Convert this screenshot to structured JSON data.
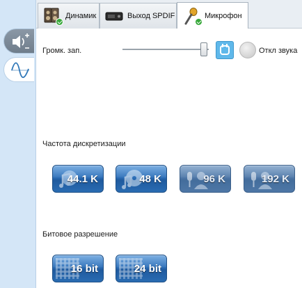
{
  "tabs": [
    {
      "label": "Динамик",
      "icon": "speaker-icon",
      "active": false
    },
    {
      "label": "Выход SPDIF",
      "icon": "spdif-icon",
      "active": false
    },
    {
      "label": "Микрофон",
      "icon": "microphone-icon",
      "active": true
    }
  ],
  "side": {
    "speaker_icon": "speaker-plus-minus-icon",
    "wave_icon": "waveform-icon"
  },
  "volume": {
    "label": "Громк. зап.",
    "level_percent": 100,
    "mute_label": "Откл звука"
  },
  "sample_rate": {
    "label": "Частота дискретизации",
    "options": [
      {
        "label": "44.1 K",
        "selected": true
      },
      {
        "label": "48 K",
        "selected": true
      },
      {
        "label": "96 K",
        "selected": false
      },
      {
        "label": "192 K",
        "selected": false
      }
    ]
  },
  "bit_depth": {
    "label": "Битовое разрешение",
    "options": [
      {
        "label": "16 bit",
        "selected": true
      },
      {
        "label": "24 bit",
        "selected": true
      }
    ]
  },
  "colors": {
    "left_strip": "#d4e6f7",
    "pill_active": "#2d6fb8",
    "pill_inactive": "#4f78a8",
    "link_button": "#5fb8ea",
    "check_green": "#37a83a"
  }
}
